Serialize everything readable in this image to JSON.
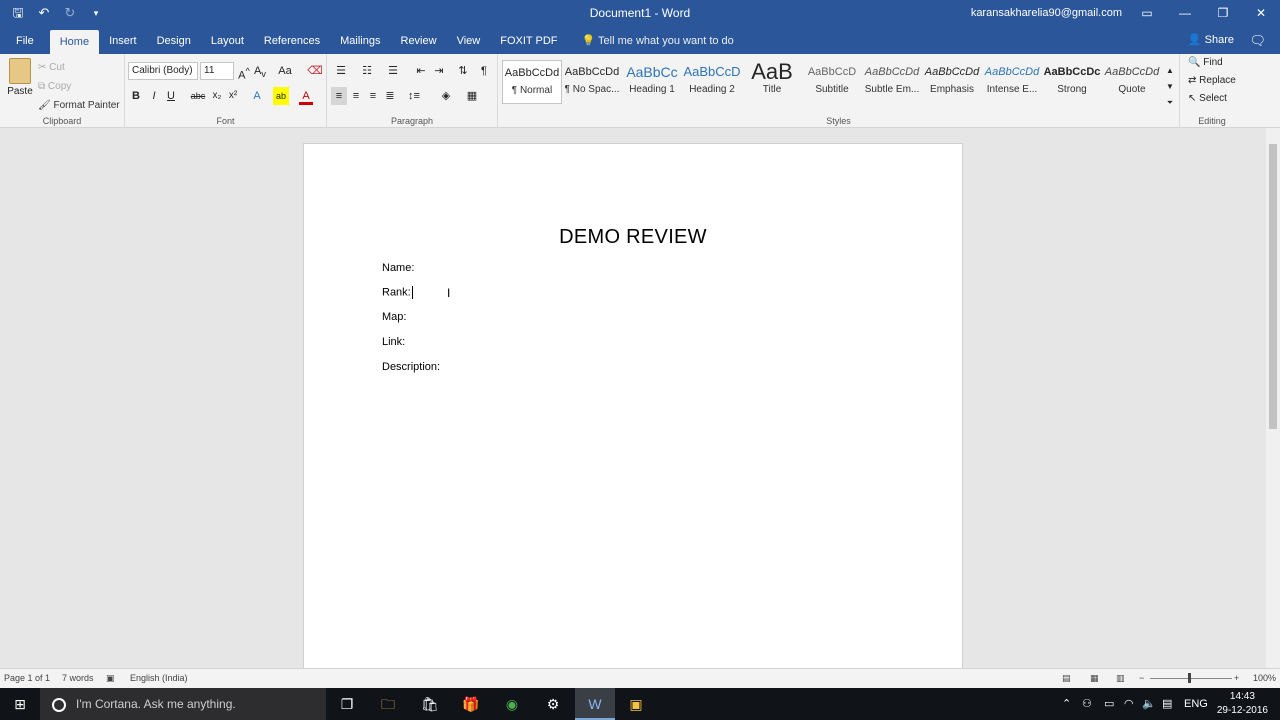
{
  "window": {
    "doc_title": "Document1  -  Word",
    "account": "karansakharelia90@gmail.com"
  },
  "qat": [
    "save-icon",
    "undo-icon",
    "redo-icon",
    "customize-icon"
  ],
  "tabs": [
    {
      "label": "File"
    },
    {
      "label": "Home"
    },
    {
      "label": "Insert"
    },
    {
      "label": "Design"
    },
    {
      "label": "Layout"
    },
    {
      "label": "References"
    },
    {
      "label": "Mailings"
    },
    {
      "label": "Review"
    },
    {
      "label": "View"
    },
    {
      "label": "FOXIT PDF"
    }
  ],
  "tell_me": "Tell me what you want to do",
  "share": "Share",
  "clipboard": {
    "paste": "Paste",
    "cut": "Cut",
    "copy": "Copy",
    "format_painter": "Format Painter",
    "label": "Clipboard"
  },
  "font": {
    "name": "Calibri (Body)",
    "size": "11",
    "label": "Font",
    "bold": "B",
    "italic": "I",
    "underline": "U",
    "strike": "abc",
    "subscript": "x₂",
    "superscript": "x²"
  },
  "paragraph": {
    "label": "Paragraph",
    "pilcrow": "¶"
  },
  "styles": {
    "label": "Styles",
    "items": [
      {
        "sample": "AaBbCcDd",
        "name": "¶ Normal"
      },
      {
        "sample": "AaBbCcDd",
        "name": "¶ No Spac..."
      },
      {
        "sample": "AaBbCc",
        "name": "Heading 1"
      },
      {
        "sample": "AaBbCcD",
        "name": "Heading 2"
      },
      {
        "sample": "AaB",
        "name": "Title"
      },
      {
        "sample": "AaBbCcD",
        "name": "Subtitle"
      },
      {
        "sample": "AaBbCcDd",
        "name": "Subtle Em..."
      },
      {
        "sample": "AaBbCcDd",
        "name": "Emphasis"
      },
      {
        "sample": "AaBbCcDd",
        "name": "Intense E..."
      },
      {
        "sample": "AaBbCcDc",
        "name": "Strong"
      },
      {
        "sample": "AaBbCcDd",
        "name": "Quote"
      }
    ]
  },
  "editing": {
    "find": "Find",
    "replace": "Replace",
    "select": "Select",
    "label": "Editing"
  },
  "document": {
    "heading": "DEMO REVIEW",
    "fields": [
      "Name:",
      "Rank:",
      "Map:",
      "Link:",
      "Description:"
    ]
  },
  "status": {
    "page": "Page 1 of 1",
    "words": "7 words",
    "language": "English (India)",
    "zoom": "100%"
  },
  "taskbar": {
    "cortana": "I'm Cortana. Ask me anything.",
    "lang": "ENG",
    "time": "14:43",
    "date": "29-12-2016"
  }
}
